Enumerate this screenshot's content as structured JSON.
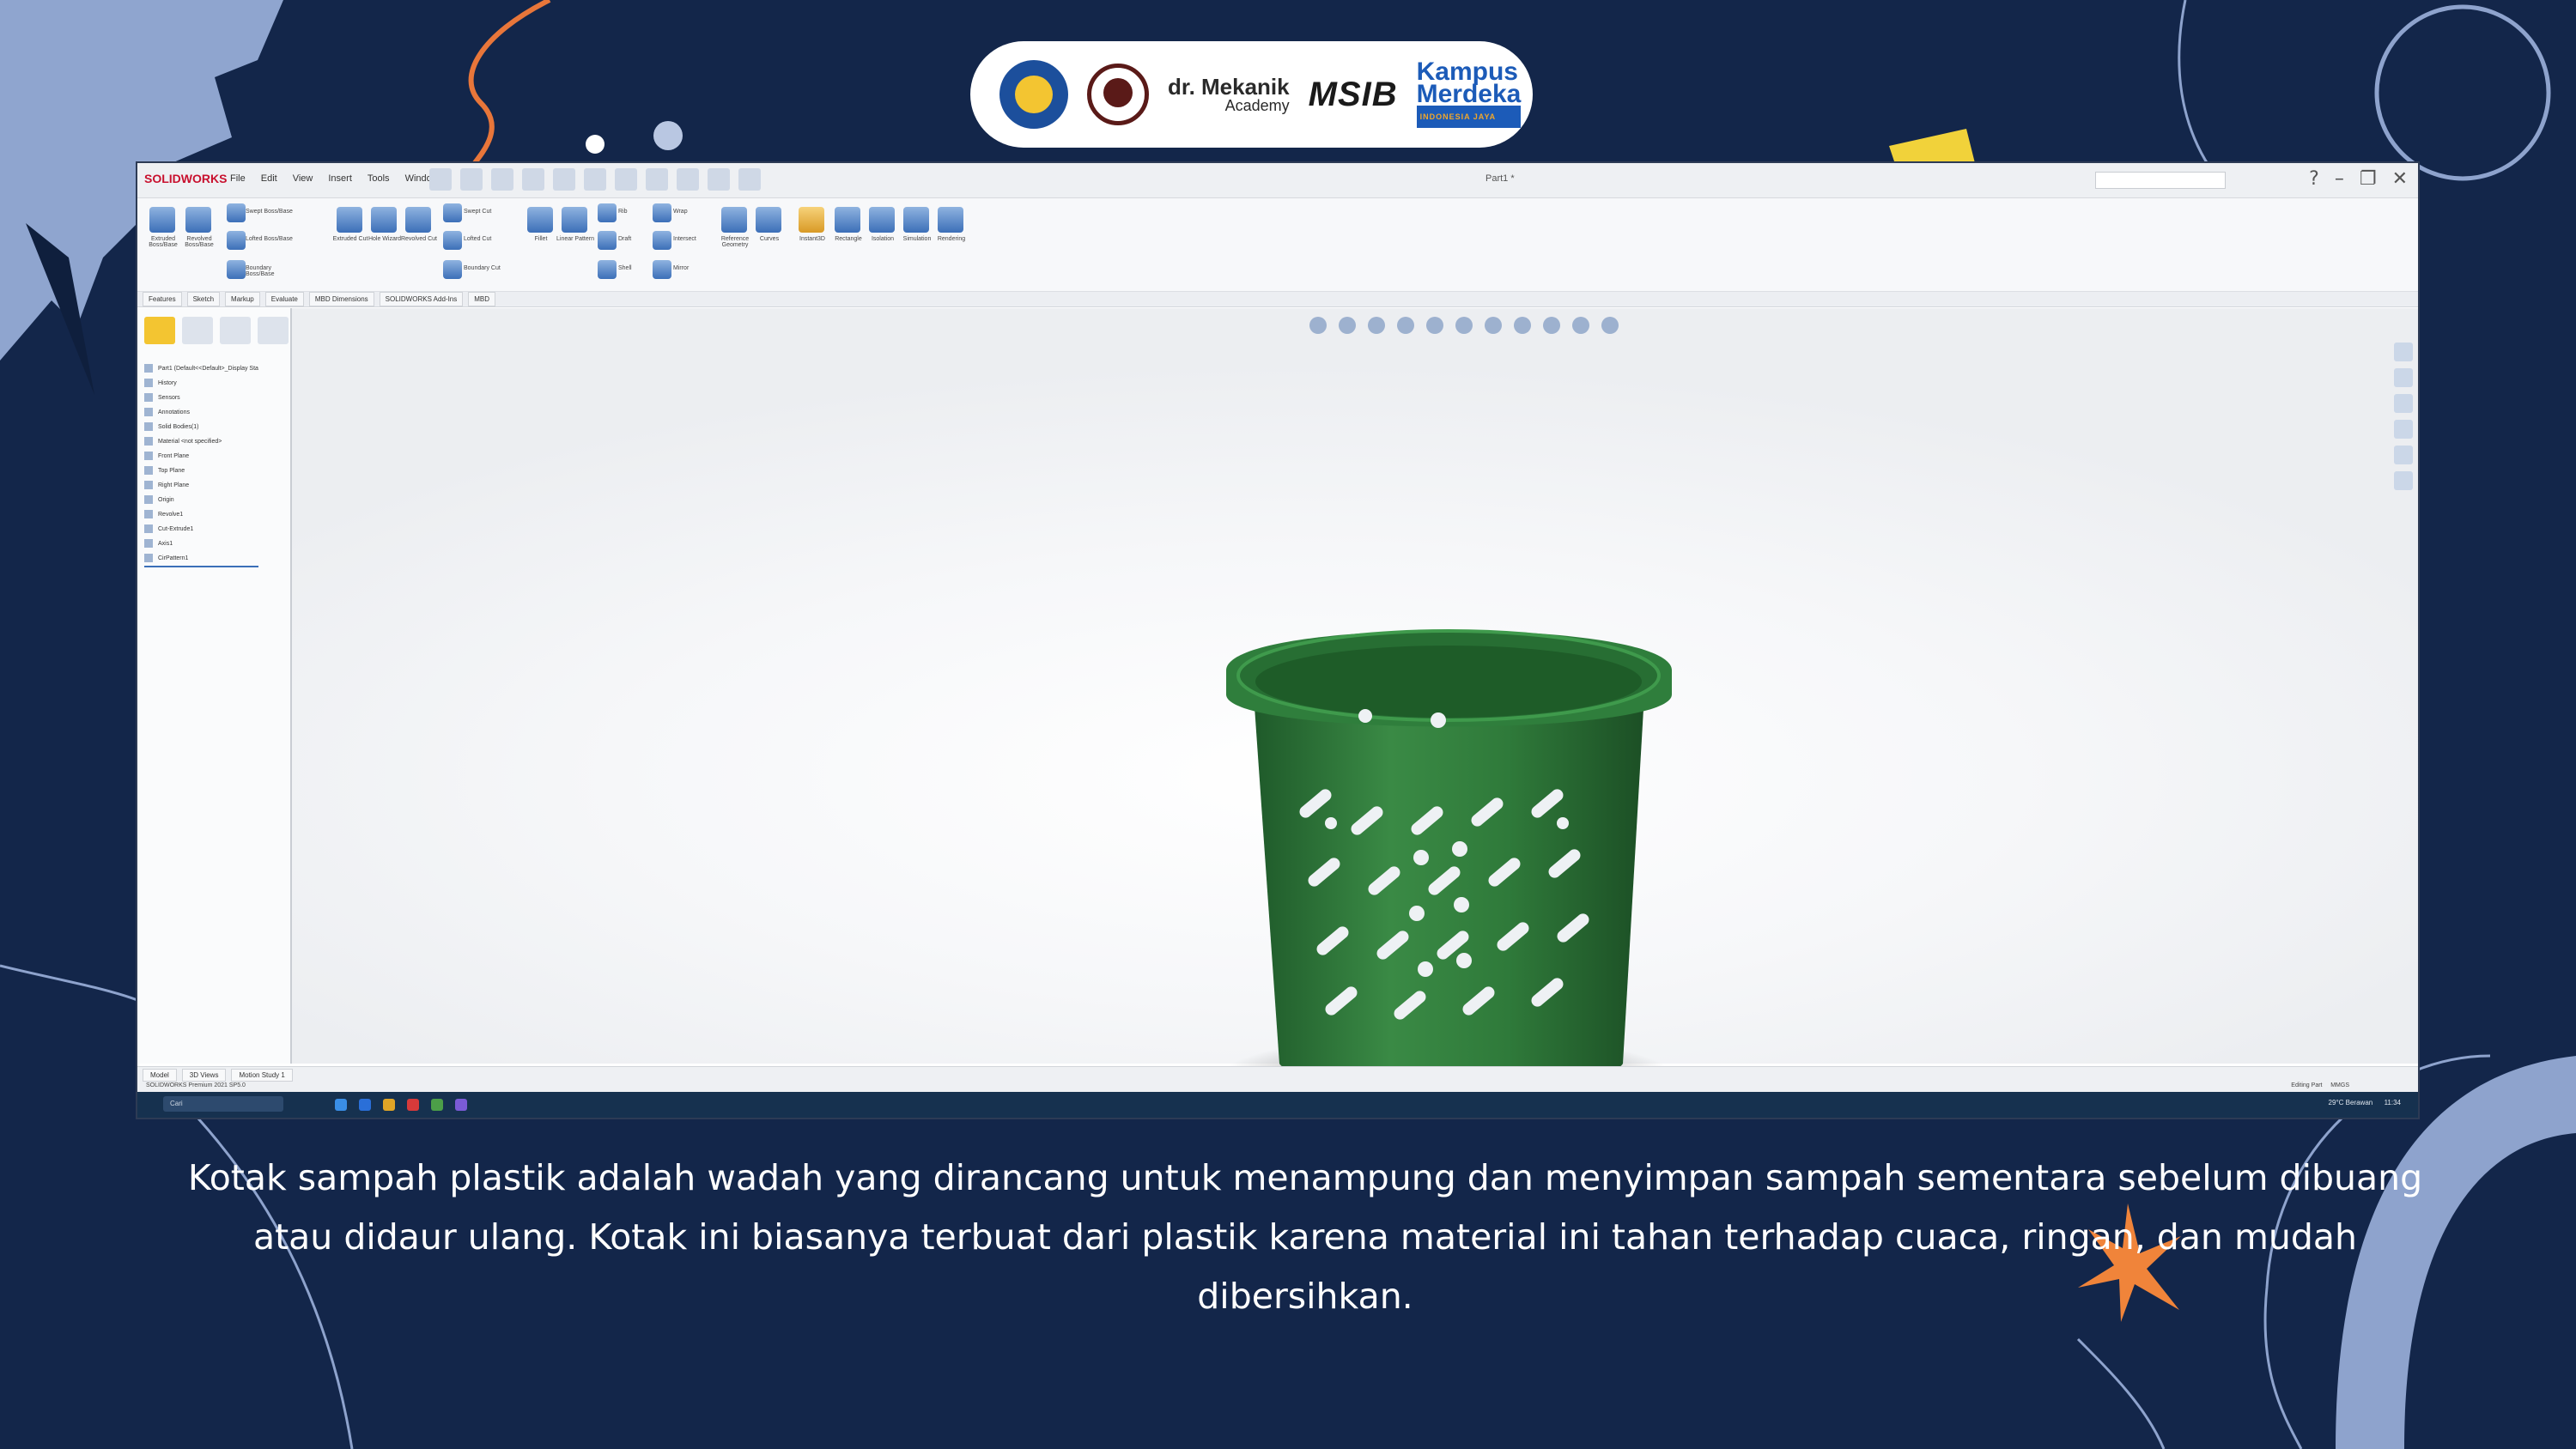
{
  "colors": {
    "background": "#13264a",
    "accent_light_blue": "#7d98c8",
    "accent_orange": "#f0843a",
    "bucket_green": "#2f7a3a"
  },
  "logos": {
    "mechanic_line1": "dr. Mekanik",
    "mechanic_line2": "Academy",
    "msib": "MSIB",
    "kampus_line1": "Kampus",
    "kampus_line2": "Merdeka",
    "kampus_sub": "INDONESIA JAYA"
  },
  "app": {
    "name": "SOLIDWORKS",
    "menus": [
      "File",
      "Edit",
      "View",
      "Insert",
      "Tools",
      "Window"
    ],
    "document_title": "Part1 *",
    "ribbon_buttons": [
      "Extruded Boss/Base",
      "Revolved Boss/Base",
      "Swept Boss/Base",
      "Lofted Boss/Base",
      "Boundary Boss/Base",
      "Extruded Cut",
      "Hole Wizard",
      "Revolved Cut",
      "Swept Cut",
      "Lofted Cut",
      "Boundary Cut",
      "Fillet",
      "Linear Pattern",
      "Rib",
      "Draft",
      "Shell",
      "Wrap",
      "Intersect",
      "Mirror",
      "Reference Geometry",
      "Curves",
      "Instant3D",
      "Rectangle",
      "Isolation",
      "Simulation",
      "Rendering"
    ],
    "command_tabs": [
      "Features",
      "Sketch",
      "Markup",
      "Evaluate",
      "MBD Dimensions",
      "SOLIDWORKS Add-Ins",
      "MBD"
    ],
    "feature_tree": [
      "Part1 (Default<<Default>_Display Sta",
      "History",
      "Sensors",
      "Annotations",
      "Solid Bodies(1)",
      "Material <not specified>",
      "Front Plane",
      "Top Plane",
      "Right Plane",
      "Origin",
      "Revolve1",
      "Cut-Extrude1",
      "Axis1",
      "CirPattern1"
    ],
    "bottom_tabs": [
      "Model",
      "3D Views",
      "Motion Study 1"
    ],
    "status_left": "SOLIDWORKS Premium 2021 SP5.0",
    "status_right": "Editing Part",
    "status_units": "MMGS",
    "taskbar_search": "Cari",
    "taskbar_weather": "29°C Berawan",
    "taskbar_time": "11:34"
  },
  "caption": {
    "text": "Kotak sampah plastik adalah wadah yang dirancang untuk menampung dan menyimpan sampah sementara sebelum dibuang atau didaur ulang. Kotak ini biasanya terbuat dari plastik karena material ini tahan terhadap cuaca, ringan, dan mudah dibersihkan."
  }
}
